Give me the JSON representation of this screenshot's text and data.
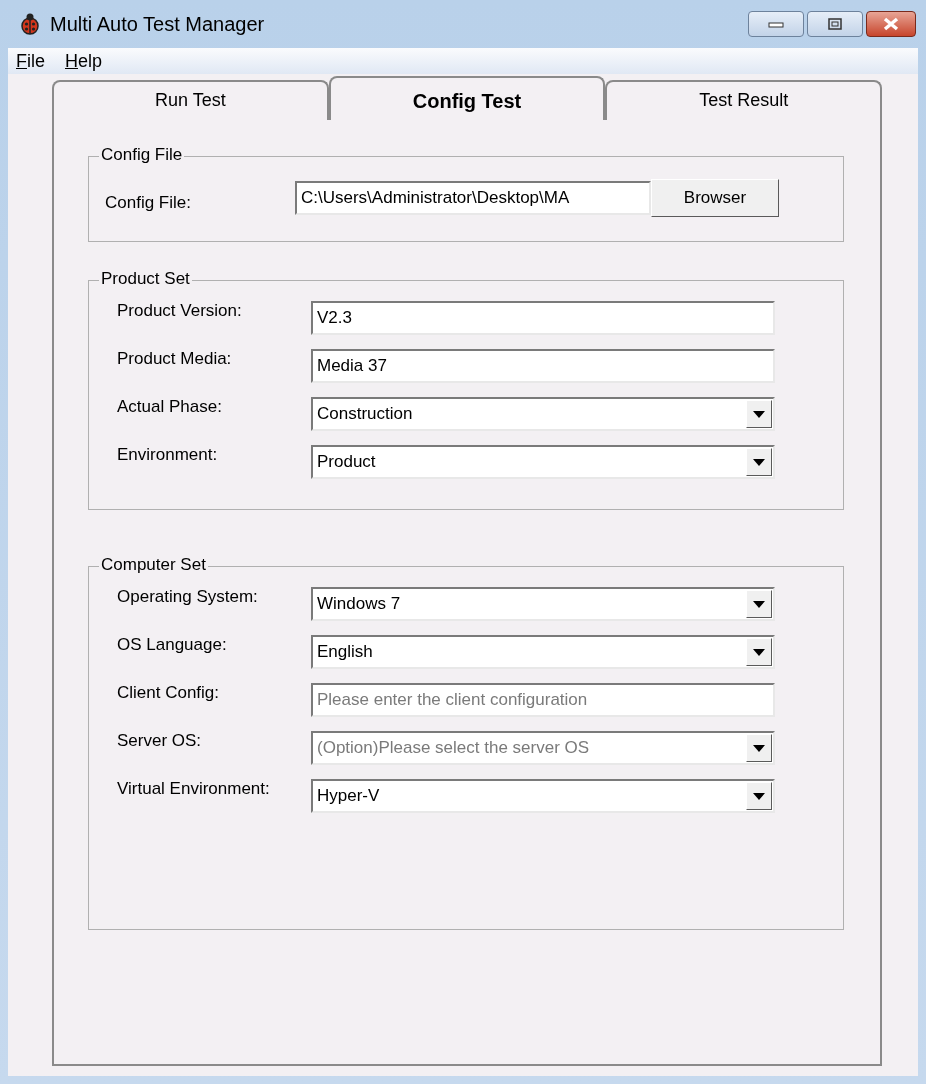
{
  "window": {
    "title": "Multi Auto Test Manager"
  },
  "menu": [
    "File",
    "Help"
  ],
  "tabs": [
    {
      "label": "Run Test",
      "selected": false
    },
    {
      "label": "Config Test",
      "selected": true
    },
    {
      "label": "Test Result",
      "selected": false
    }
  ],
  "groups": [
    {
      "title": "Config File",
      "kind": "file",
      "label": "Config File:",
      "value": "C:\\Users\\Administrator\\Desktop\\MA",
      "button": "Browser"
    },
    {
      "title": "Product Set",
      "kind": "fields",
      "fields": [
        {
          "label": "Product Version:",
          "kind": "text",
          "value": "V2.3"
        },
        {
          "label": "Product Media:",
          "kind": "text",
          "value": "Media 37"
        },
        {
          "label": "Actual Phase:",
          "kind": "dropdown",
          "value": "Construction"
        },
        {
          "label": "Environment:",
          "kind": "dropdown",
          "value": "Product"
        }
      ]
    },
    {
      "title": "Computer Set",
      "kind": "fields",
      "fields": [
        {
          "label": "Operating System:",
          "kind": "dropdown",
          "value": "Windows 7"
        },
        {
          "label": "OS Language:",
          "kind": "dropdown",
          "value": "English"
        },
        {
          "label": "Client Config:",
          "kind": "text",
          "placeholder": "Please enter the client configuration"
        },
        {
          "label": "Server OS:",
          "kind": "dropdown",
          "placeholder": "(Option)Please select the server OS"
        },
        {
          "label": "Virtual Environment:",
          "kind": "dropdown",
          "value": "Hyper-V"
        }
      ]
    }
  ]
}
